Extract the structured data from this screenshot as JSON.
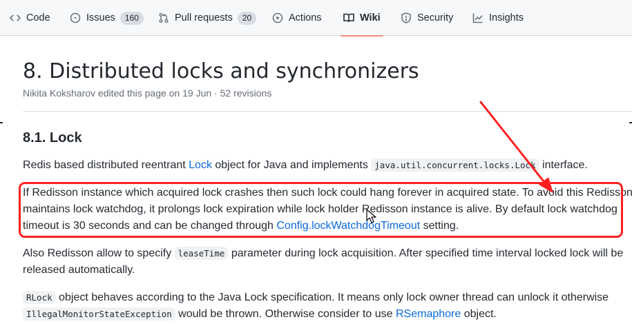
{
  "nav": {
    "tabs": [
      {
        "label": "Code",
        "icon": "code-icon"
      },
      {
        "label": "Issues",
        "icon": "issue-opened-icon",
        "count": "160"
      },
      {
        "label": "Pull requests",
        "icon": "git-pull-request-icon",
        "count": "20"
      },
      {
        "label": "Actions",
        "icon": "play-icon"
      },
      {
        "label": "Wiki",
        "icon": "book-icon",
        "selected": true
      },
      {
        "label": "Security",
        "icon": "shield-icon"
      },
      {
        "label": "Insights",
        "icon": "graph-icon"
      }
    ]
  },
  "page": {
    "title": "8. Distributed locks and synchronizers",
    "meta": "Nikita Koksharov edited this page on 19 Jun · 52 revisions"
  },
  "section": {
    "heading": "8.1. Lock",
    "p1": {
      "t1": "Redis based distributed reentrant ",
      "link1": "Lock",
      "t2": " object for Java and implements ",
      "code1": "java.util.concurrent.locks.Lock",
      "t3": " interface."
    },
    "p2": {
      "line1": "If Redisson instance which acquired lock crashes then such lock could hang forever in acquired state. To avoid this Redisson",
      "line2": "maintains lock watchdog, it prolongs lock expiration while lock holder Redisson instance is alive. By default lock watchdog",
      "line3a": "timeout is 30 seconds and can be changed through ",
      "link": "Config.lockWatchdogTimeout",
      "line3b": " setting."
    },
    "p3": {
      "t1": "Also Redisson allow to specify ",
      "code": "leaseTime",
      "t2": " parameter during lock acquisition. After specified time interval locked lock will be",
      "line2": "released automatically."
    },
    "p4": {
      "code1": "RLock",
      "t1": " object behaves according to the Java Lock specification. It means only lock owner thread can unlock it otherwise",
      "code2": "IllegalMonitorStateException",
      "t2": " would be thrown. Otherwise consider to use ",
      "link": "RSemaphore",
      "t3": " object."
    }
  },
  "annotation": {
    "color": "#ff1f1f"
  }
}
